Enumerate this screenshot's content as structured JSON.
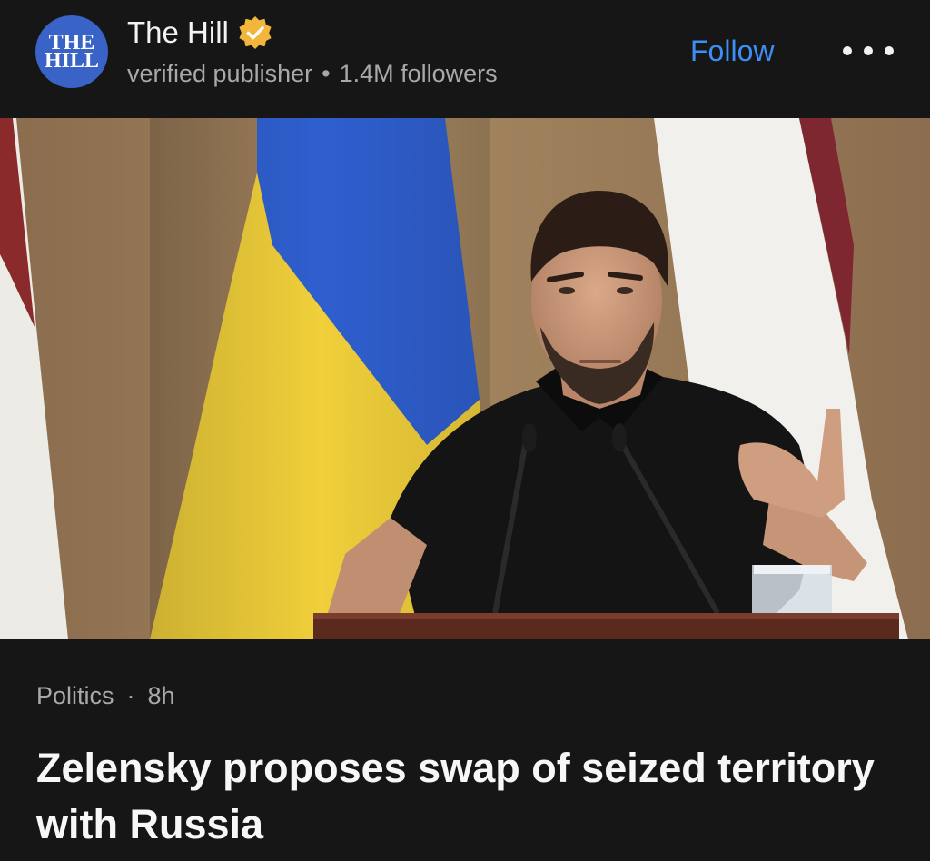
{
  "publisher": {
    "logo_line1": "THE",
    "logo_line2": "HILL",
    "name": "The Hill",
    "badge_icon": "verified-check-icon",
    "verified_label": "verified publisher",
    "separator": "•",
    "followers": "1.4M followers",
    "follow_label": "Follow",
    "more_icon": "more-options-icon"
  },
  "article": {
    "category": "Politics",
    "separator": "·",
    "age": "8h",
    "headline": "Zelensky proposes swap of seized territory with Russia"
  },
  "colors": {
    "background": "#161616",
    "accent": "#3d8ef5",
    "logo_bg": "#3a63c7",
    "badge": "#f2b63a",
    "muted_text": "#a9a9a9"
  }
}
